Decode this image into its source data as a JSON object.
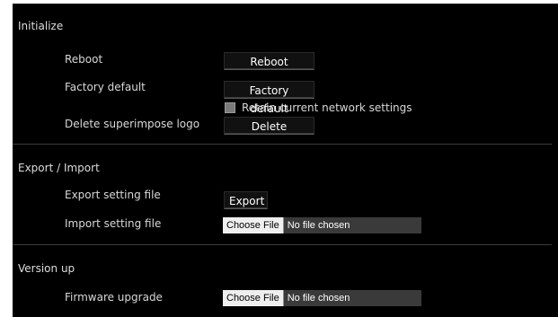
{
  "initialize": {
    "heading": "Initialize",
    "reboot_label": "Reboot",
    "reboot_button": "Reboot",
    "factory_default_label": "Factory default",
    "factory_default_button": "Factory default",
    "retain_network_label": "Retain current network settings",
    "retain_network_checked": false,
    "delete_logo_label": "Delete superimpose logo",
    "delete_button": "Delete"
  },
  "export_import": {
    "heading": "Export / Import",
    "export_label": "Export setting file",
    "export_button": "Export",
    "import_label": "Import setting file",
    "import_choose_button": "Choose File",
    "import_file_status": "No file chosen"
  },
  "version_up": {
    "heading": "Version up",
    "firmware_label": "Firmware upgrade",
    "firmware_choose_button": "Choose File",
    "firmware_file_status": "No file chosen"
  },
  "colors": {
    "panel_background": "#000000",
    "text": "#d8d8d8",
    "separator": "#3c3c3c",
    "file_input_background": "#3a3a3a",
    "choose_button_background": "#efefef"
  }
}
